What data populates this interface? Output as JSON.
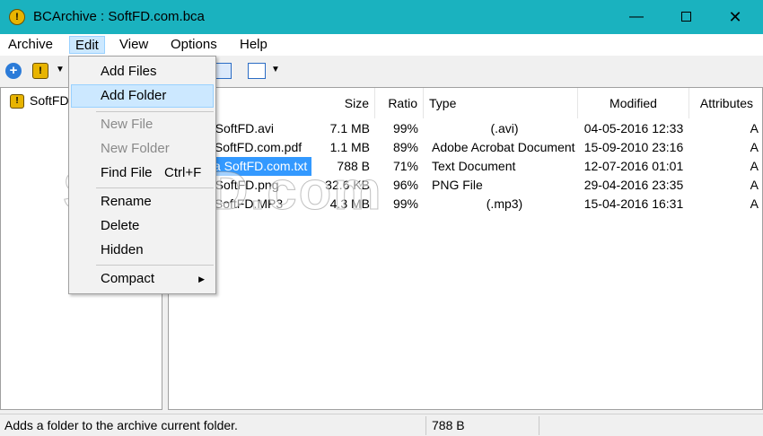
{
  "window": {
    "title": "BCArchive : SoftFD.com.bca",
    "app_icon_glyph": "!",
    "minimize_glyph": "—",
    "close_glyph": "✕"
  },
  "menubar": [
    {
      "label": "Archive"
    },
    {
      "label": "Edit",
      "open": true
    },
    {
      "label": "View"
    },
    {
      "label": "Options"
    },
    {
      "label": "Help"
    }
  ],
  "toolbar": {
    "add_glyph": "+",
    "archive_glyph": "!",
    "dropdown_glyph": "▼"
  },
  "tree": {
    "root_label": "SoftFD",
    "root_glyph": "!"
  },
  "columns": [
    "Size",
    "Ratio",
    "Type",
    "Modified",
    "Attributes"
  ],
  "files": [
    {
      "name": "o SoftFD.avi",
      "size": "7.1 MB",
      "ratio": "99%",
      "type": "(.avi)",
      "modified": "04-05-2016 12:33",
      "attr": "A"
    },
    {
      "name": "k SoftFD.com.pdf",
      "size": "1.1 MB",
      "ratio": "89%",
      "type": "Adobe Acrobat Document",
      "modified": "15-09-2010 23:16",
      "attr": "A"
    },
    {
      "name": "a SoftFD.com.txt",
      "size": "788 B",
      "ratio": "71%",
      "type": "Text Document",
      "modified": "12-07-2016 01:01",
      "attr": "A",
      "selected": true
    },
    {
      "name": "o SoftFD.png",
      "size": "32.6 KB",
      "ratio": "96%",
      "type": "PNG File",
      "modified": "29-04-2016 23:35",
      "attr": "A"
    },
    {
      "name": "c SoftFD.MP3",
      "size": "4.3 MB",
      "ratio": "99%",
      "type": "(.mp3)",
      "modified": "15-04-2016 16:31",
      "attr": "A"
    }
  ],
  "edit_menu": {
    "add_files": "Add Files",
    "add_folder": "Add Folder",
    "new_file": "New File",
    "new_folder": "New Folder",
    "find_file": "Find File",
    "find_file_shortcut": "Ctrl+F",
    "rename": "Rename",
    "delete": "Delete",
    "hidden": "Hidden",
    "compact": "Compact",
    "submenu_glyph": "▶"
  },
  "status": {
    "message": "Adds a folder to the archive current folder.",
    "size": "788 B"
  },
  "watermark": "SoftFD.com",
  "colors": {
    "titlebar": "#1ab2bf",
    "selection": "#3399ff",
    "menu_highlight": "#cce8ff"
  }
}
